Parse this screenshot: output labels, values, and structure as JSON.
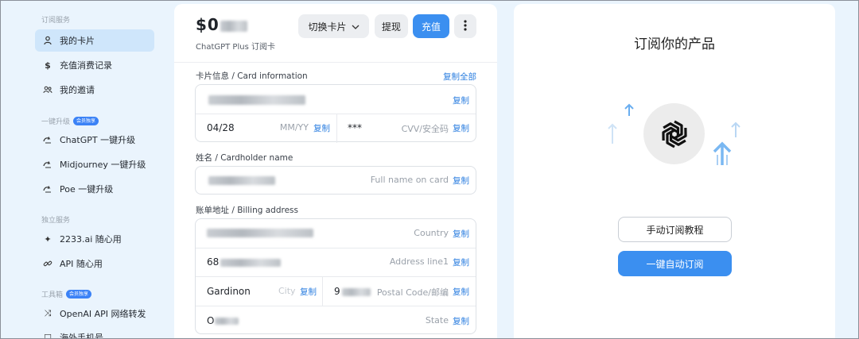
{
  "sidebar": {
    "sections": [
      {
        "title": "订阅服务",
        "badge": ""
      },
      {
        "title": "一键升级",
        "badge": "会员独享"
      },
      {
        "title": "独立服务",
        "badge": ""
      },
      {
        "title": "工具箱",
        "badge": "会员独享"
      }
    ],
    "items": [
      {
        "label": "我的卡片",
        "icon": "card-user-icon"
      },
      {
        "label": "充值消费记录",
        "icon": "dollar-icon"
      },
      {
        "label": "我的邀请",
        "icon": "users-icon"
      },
      {
        "label": "ChatGPT 一键升级",
        "icon": "upgrade-icon"
      },
      {
        "label": "Midjourney 一键升级",
        "icon": "upgrade-icon"
      },
      {
        "label": "Poe 一键升级",
        "icon": "upgrade-icon"
      },
      {
        "label": "2233.ai 随心用",
        "icon": "sparkle-icon"
      },
      {
        "label": "API 随心用",
        "icon": "link-icon"
      },
      {
        "label": "OpenAI API 网络转发",
        "icon": "shuffle-icon"
      },
      {
        "label": "海外手机号",
        "icon": "phone-icon"
      }
    ]
  },
  "card": {
    "balance_prefix": "$0",
    "subtitle": "ChatGPT Plus 订阅卡",
    "switch_label": "切换卡片",
    "withdraw_label": "提现",
    "recharge_label": "充值",
    "more_icon": "more-vertical-icon"
  },
  "card_info": {
    "label": "卡片信息 / Card information",
    "copy_all": "复制全部",
    "expiry": "04/28",
    "expiry_placeholder": "MM/YY",
    "cvv": "***",
    "cvv_placeholder": "CVV/安全码",
    "copy": "复制"
  },
  "cardholder": {
    "label": "姓名 / Cardholder name",
    "placeholder": "Full name on card",
    "copy": "复制"
  },
  "billing": {
    "label": "账单地址 / Billing address",
    "country_placeholder": "Country",
    "address_value_prefix": "68",
    "address_placeholder": "Address line1",
    "city_value": "Gardinon",
    "city_placeholder": "City",
    "postal_value_prefix": "9",
    "postal_placeholder": "Postal Code/邮编",
    "state_value_prefix": "O",
    "state_placeholder": "State",
    "copy": "复制"
  },
  "right": {
    "title": "订阅你的产品",
    "tutorial_label": "手动订阅教程",
    "one_click_label": "一键自动订阅",
    "logo_icon": "openai-logo-icon"
  },
  "colors": {
    "accent": "#3b8ff0",
    "link": "#2d7fe0",
    "active_nav": "#cfe6fb",
    "background": "#eaf4fd"
  }
}
